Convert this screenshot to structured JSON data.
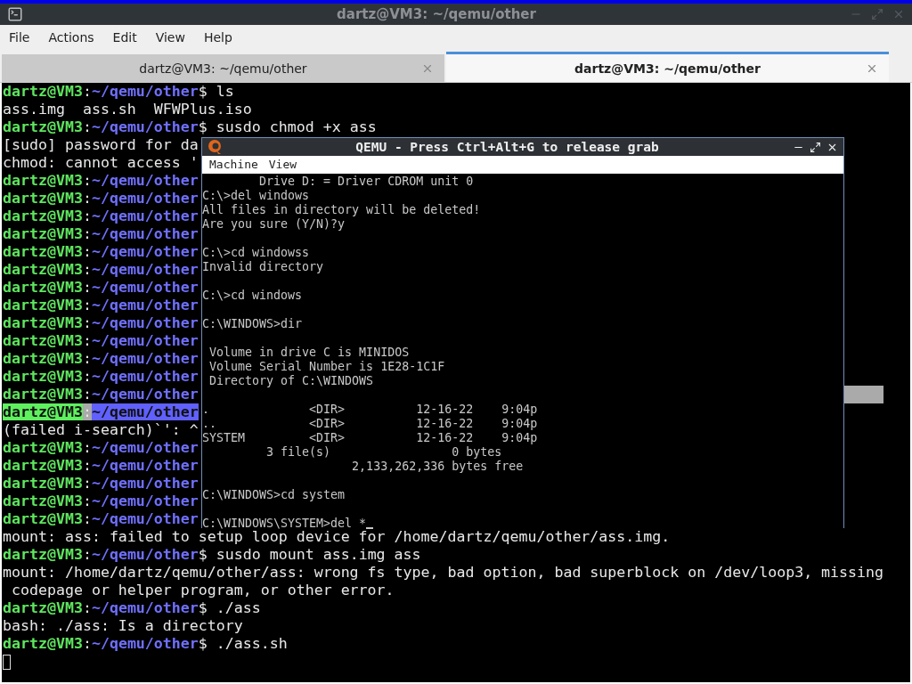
{
  "window": {
    "title": "dartz@VM3: ~/qemu/other"
  },
  "menu": [
    "File",
    "Actions",
    "Edit",
    "View",
    "Help"
  ],
  "tabs": [
    {
      "label": "dartz@VM3: ~/qemu/other",
      "selected": false
    },
    {
      "label": "dartz@VM3: ~/qemu/other",
      "selected": true
    }
  ],
  "terminal": [
    {
      "kind": "prompt",
      "user": "dartz@VM3",
      "colon": ":",
      "path": "~/qemu/other",
      "dollar": "$",
      "command": "ls",
      "highlighted": false
    },
    {
      "kind": "output",
      "text": "ass.img  ass.sh  WFWPlus.iso"
    },
    {
      "kind": "prompt",
      "user": "dartz@VM3",
      "colon": ":",
      "path": "~/qemu/other",
      "dollar": "$",
      "command": "susdo chmod +x ass",
      "highlighted": false
    },
    {
      "kind": "output",
      "text": "[sudo] password for da"
    },
    {
      "kind": "output",
      "text": "chmod: cannot access '"
    },
    {
      "kind": "prompt",
      "user": "dartz@VM3",
      "colon": ":",
      "path": "~/qemu/other",
      "highlighted": false
    },
    {
      "kind": "prompt",
      "user": "dartz@VM3",
      "colon": ":",
      "path": "~/qemu/other",
      "highlighted": false
    },
    {
      "kind": "prompt",
      "user": "dartz@VM3",
      "colon": ":",
      "path": "~/qemu/other",
      "highlighted": false
    },
    {
      "kind": "prompt",
      "user": "dartz@VM3",
      "colon": ":",
      "path": "~/qemu/other",
      "highlighted": false
    },
    {
      "kind": "prompt",
      "user": "dartz@VM3",
      "colon": ":",
      "path": "~/qemu/other",
      "highlighted": false
    },
    {
      "kind": "prompt",
      "user": "dartz@VM3",
      "colon": ":",
      "path": "~/qemu/other",
      "highlighted": false
    },
    {
      "kind": "prompt",
      "user": "dartz@VM3",
      "colon": ":",
      "path": "~/qemu/other",
      "highlighted": false
    },
    {
      "kind": "prompt",
      "user": "dartz@VM3",
      "colon": ":",
      "path": "~/qemu/other",
      "highlighted": false
    },
    {
      "kind": "prompt",
      "user": "dartz@VM3",
      "colon": ":",
      "path": "~/qemu/other",
      "highlighted": false
    },
    {
      "kind": "prompt",
      "user": "dartz@VM3",
      "colon": ":",
      "path": "~/qemu/other",
      "highlighted": false
    },
    {
      "kind": "prompt",
      "user": "dartz@VM3",
      "colon": ":",
      "path": "~/qemu/other",
      "highlighted": false
    },
    {
      "kind": "prompt",
      "user": "dartz@VM3",
      "colon": ":",
      "path": "~/qemu/other",
      "highlighted": false
    },
    {
      "kind": "prompt",
      "user": "dartz@VM3",
      "colon": ":",
      "path": "~/qemu/other",
      "highlighted": false,
      "trailing_selection": true
    },
    {
      "kind": "prompt",
      "user": "dartz@VM3",
      "colon": ":",
      "path": "~/qemu/other",
      "highlighted": true
    },
    {
      "kind": "output",
      "text": "(failed i-search)`': ^"
    },
    {
      "kind": "prompt",
      "user": "dartz@VM3",
      "colon": ":",
      "path": "~/qemu/other",
      "highlighted": false
    },
    {
      "kind": "prompt",
      "user": "dartz@VM3",
      "colon": ":",
      "path": "~/qemu/other",
      "highlighted": false
    },
    {
      "kind": "prompt",
      "user": "dartz@VM3",
      "colon": ":",
      "path": "~/qemu/other",
      "highlighted": false
    },
    {
      "kind": "prompt",
      "user": "dartz@VM3",
      "colon": ":",
      "path": "~/qemu/other",
      "highlighted": false
    },
    {
      "kind": "prompt",
      "user": "dartz@VM3",
      "colon": ":",
      "path": "~/qemu/other",
      "highlighted": false
    },
    {
      "kind": "output",
      "text": "mount: ass: failed to setup loop device for /home/dartz/qemu/other/ass.img."
    },
    {
      "kind": "prompt",
      "user": "dartz@VM3",
      "colon": ":",
      "path": "~/qemu/other",
      "dollar": "$",
      "command": "susdo mount ass.img ass",
      "highlighted": false
    },
    {
      "kind": "output",
      "text": "mount: /home/dartz/qemu/other/ass: wrong fs type, bad option, bad superblock on /dev/loop3, missing"
    },
    {
      "kind": "output",
      "text": " codepage or helper program, or other error."
    },
    {
      "kind": "prompt",
      "user": "dartz@VM3",
      "colon": ":",
      "path": "~/qemu/other",
      "dollar": "$",
      "command": "./ass",
      "highlighted": false
    },
    {
      "kind": "output",
      "text": "bash: ./ass: Is a directory"
    },
    {
      "kind": "prompt",
      "user": "dartz@VM3",
      "colon": ":",
      "path": "~/qemu/other",
      "dollar": "$",
      "command": "./ass.sh",
      "highlighted": false
    },
    {
      "kind": "cursor"
    }
  ],
  "qemu": {
    "title": "QEMU - Press Ctrl+Alt+G to release grab",
    "menu": [
      "Machine",
      "View"
    ],
    "screen": [
      {
        "kind": "text",
        "text": "        Drive D: = Driver CDROM unit 0"
      },
      {
        "kind": "text",
        "text": "C:\\>del windows"
      },
      {
        "kind": "text",
        "text": "All files in directory will be deleted!"
      },
      {
        "kind": "text",
        "text": "Are you sure (Y/N)?y"
      },
      {
        "kind": "blank"
      },
      {
        "kind": "text",
        "text": "C:\\>cd windowss"
      },
      {
        "kind": "text",
        "text": "Invalid directory"
      },
      {
        "kind": "blank"
      },
      {
        "kind": "text",
        "text": "C:\\>cd windows"
      },
      {
        "kind": "blank"
      },
      {
        "kind": "text",
        "text": "C:\\WINDOWS>dir"
      },
      {
        "kind": "blank"
      },
      {
        "kind": "text",
        "text": " Volume in drive C is MINIDOS"
      },
      {
        "kind": "text",
        "text": " Volume Serial Number is 1E28-1C1F"
      },
      {
        "kind": "text",
        "text": " Directory of C:\\WINDOWS"
      },
      {
        "kind": "blank"
      },
      {
        "kind": "text",
        "text": ".              <DIR>          12-16-22    9:04p"
      },
      {
        "kind": "text",
        "text": "..             <DIR>          12-16-22    9:04p"
      },
      {
        "kind": "text",
        "text": "SYSTEM         <DIR>          12-16-22    9:04p"
      },
      {
        "kind": "text",
        "text": "         3 file(s)                 0 bytes"
      },
      {
        "kind": "text",
        "text": "                     2,133,262,336 bytes free"
      },
      {
        "kind": "blank"
      },
      {
        "kind": "text",
        "text": "C:\\WINDOWS>cd system"
      },
      {
        "kind": "blank"
      },
      {
        "kind": "input",
        "text": "C:\\WINDOWS\\SYSTEM>del *"
      }
    ]
  }
}
